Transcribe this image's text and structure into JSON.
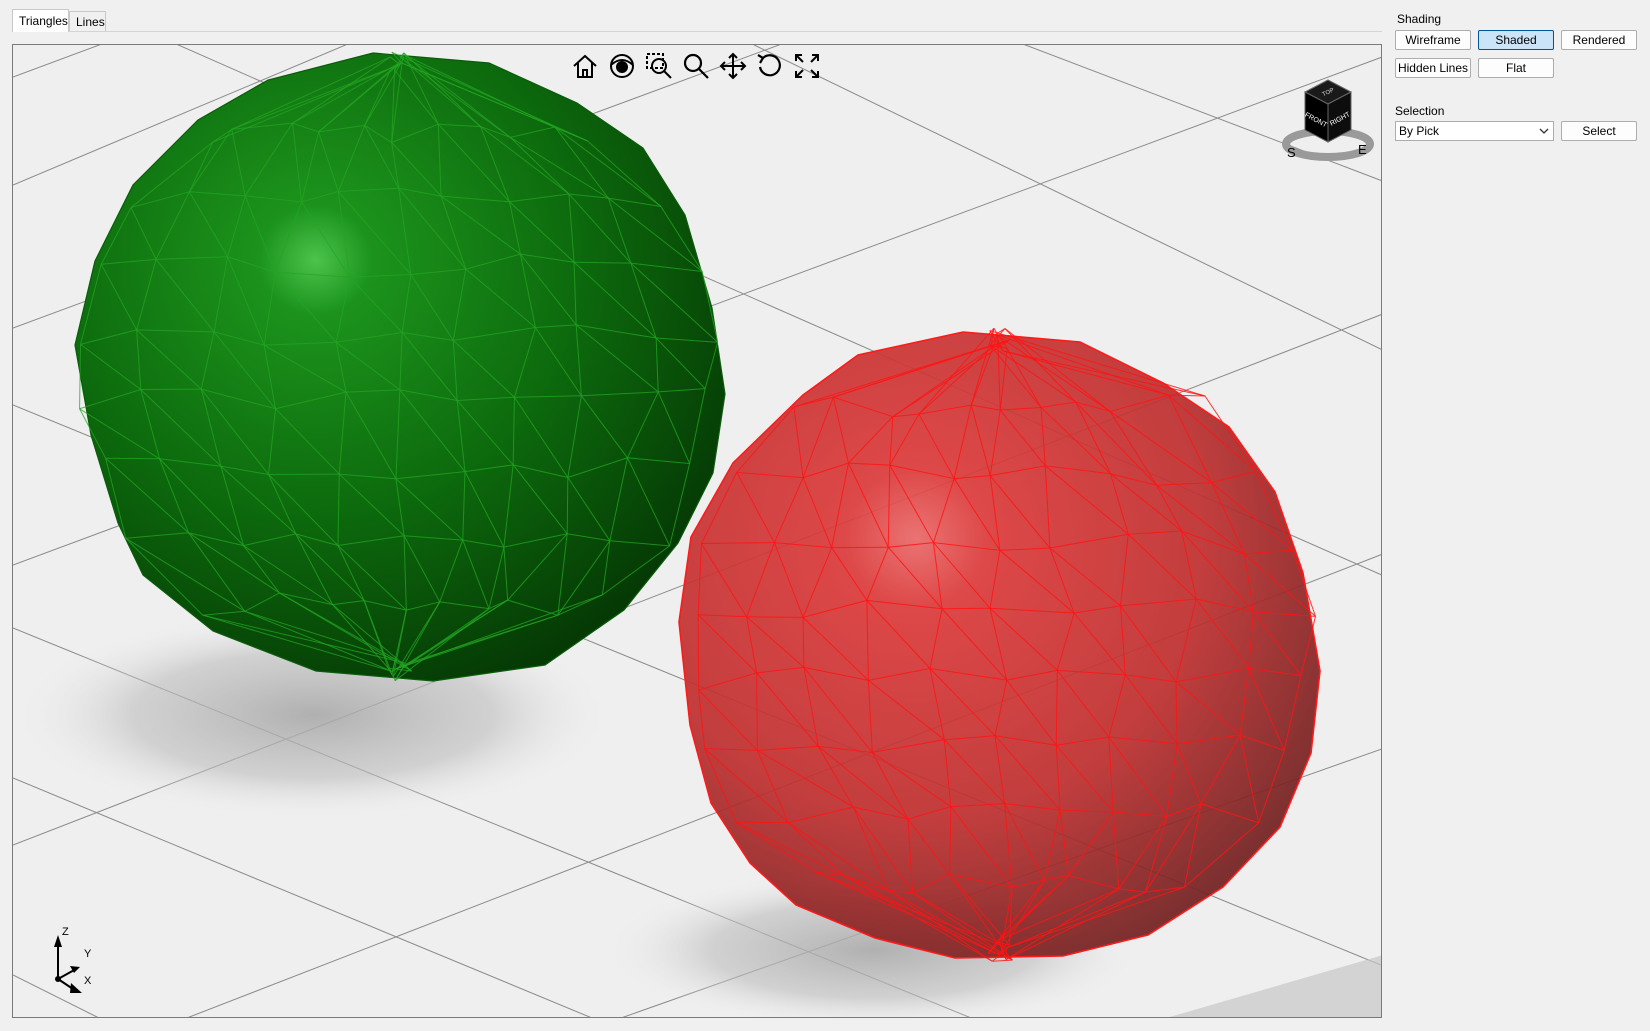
{
  "tabs": [
    {
      "label": "Triangles",
      "active": true
    },
    {
      "label": "Lines",
      "active": false
    }
  ],
  "toolbar": {
    "icons": [
      "home-icon",
      "eye-icon",
      "zoom-window-icon",
      "zoom-icon",
      "pan-icon",
      "rotate-icon",
      "fullscreen-icon"
    ]
  },
  "viewcube": {
    "top": "TOP",
    "front": "FRONT",
    "right": "RIGHT",
    "south": "S",
    "east": "E"
  },
  "axis_triad": {
    "z": "Z",
    "y": "Y",
    "x": "X"
  },
  "shading": {
    "label": "Shading",
    "wireframe": "Wireframe",
    "shaded": "Shaded",
    "rendered": "Rendered",
    "hidden_lines": "Hidden Lines",
    "flat": "Flat",
    "active": "Shaded"
  },
  "selection": {
    "label": "Selection",
    "mode": "By Pick",
    "select_button": "Select"
  },
  "scene": {
    "sphere_left_color": "#0b7a0b",
    "sphere_right_color": "#d42a2a",
    "right_edge_color": "#ff0000"
  }
}
